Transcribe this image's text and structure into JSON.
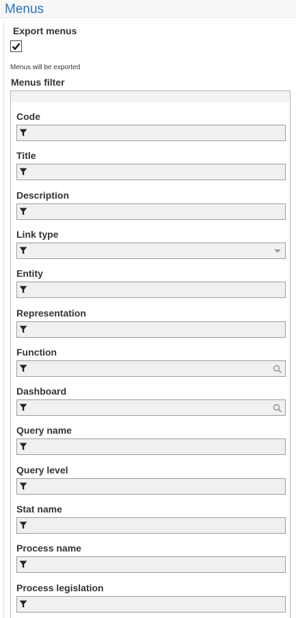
{
  "section": {
    "title": "Menus"
  },
  "export": {
    "label": "Export menus",
    "checked": true,
    "note": "Menus will be exported"
  },
  "filter": {
    "title": "Menus filter",
    "fields": [
      {
        "label": "Code",
        "control": "text"
      },
      {
        "label": "Title",
        "control": "text"
      },
      {
        "label": "Description",
        "control": "text"
      },
      {
        "label": "Link type",
        "control": "dropdown",
        "trail_icon": "chevron-down-icon"
      },
      {
        "label": "Entity",
        "control": "text"
      },
      {
        "label": "Representation",
        "control": "text"
      },
      {
        "label": "Function",
        "control": "lookup",
        "trail_icon": "search-icon"
      },
      {
        "label": "Dashboard",
        "control": "lookup",
        "trail_icon": "search-icon"
      },
      {
        "label": "Query name",
        "control": "text"
      },
      {
        "label": "Query level",
        "control": "text"
      },
      {
        "label": "Stat name",
        "control": "text"
      },
      {
        "label": "Process name",
        "control": "text"
      },
      {
        "label": "Process legislation",
        "control": "text"
      }
    ],
    "leading_icon": "funnel-icon"
  },
  "colors": {
    "title": "#2a72b8",
    "input_bg": "#f0f0f0",
    "input_border": "#9c9c9c"
  }
}
